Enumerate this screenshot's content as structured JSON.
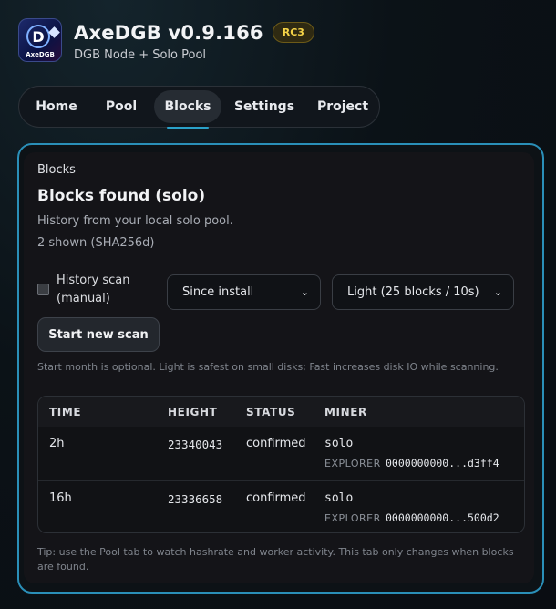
{
  "header": {
    "logo_text": "AxeDGB",
    "title": "AxeDGB v0.9.166",
    "badge": "RC3",
    "subtitle": "DGB Node + Solo Pool"
  },
  "nav": {
    "tabs": [
      {
        "label": "Home",
        "active": false
      },
      {
        "label": "Pool",
        "active": false
      },
      {
        "label": "Blocks",
        "active": true
      },
      {
        "label": "Settings",
        "active": false
      },
      {
        "label": "Project",
        "active": false
      }
    ]
  },
  "blocks": {
    "section_label": "Blocks",
    "title": "Blocks found (solo)",
    "subtitle": "History from your local solo pool.",
    "count": "2 shown (SHA256d)",
    "history_scan_label": "History scan (manual)",
    "history_scan_checked": false,
    "start_select": "Since install",
    "mode_select": "Light (25 blocks / 10s)",
    "scan_button": "Start new scan",
    "hint": "Start month is optional. Light is safest on small disks; Fast increases disk IO while scanning.",
    "table": {
      "columns": [
        "TIME",
        "HEIGHT",
        "STATUS",
        "MINER"
      ],
      "rows": [
        {
          "time": "2h",
          "height": "23340043",
          "status": "confirmed",
          "miner": "solo",
          "explorer_label": "EXPLORER",
          "hash": "0000000000...d3ff4"
        },
        {
          "time": "16h",
          "height": "23336658",
          "status": "confirmed",
          "miner": "solo",
          "explorer_label": "EXPLORER",
          "hash": "0000000000...500d2"
        }
      ]
    },
    "tip": "Tip: use the Pool tab to watch hashrate and worker activity. This tab only changes when blocks are found."
  },
  "colors": {
    "accent": "#2aa1c9",
    "badge": "#f5d347"
  }
}
